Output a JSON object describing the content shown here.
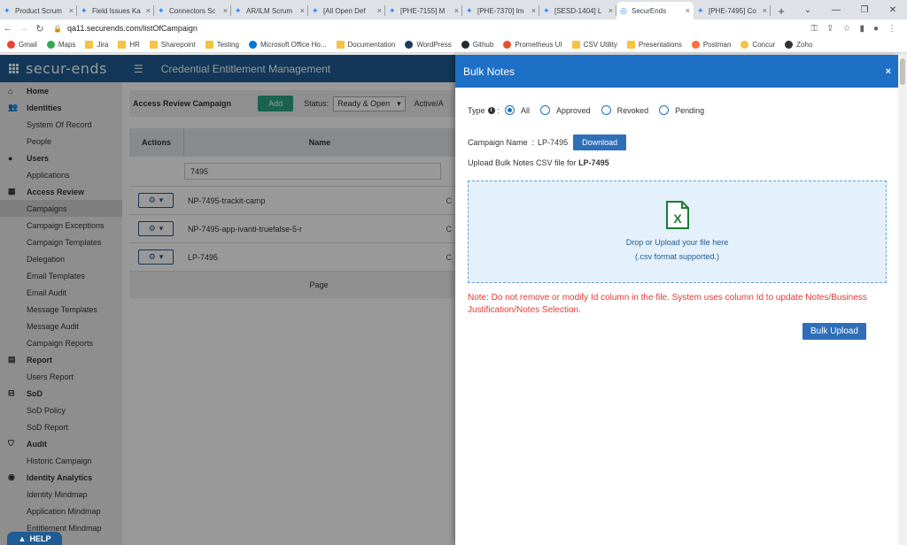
{
  "browser": {
    "tabs": [
      {
        "title": "Product Scrum"
      },
      {
        "title": "Field Issues Ka"
      },
      {
        "title": "Connectors Sc"
      },
      {
        "title": "AR/ILM Scrum"
      },
      {
        "title": "[All Open Def"
      },
      {
        "title": "[PHE-7155] M"
      },
      {
        "title": "[PHE-7370] Im"
      },
      {
        "title": "[SESD-1404] L"
      },
      {
        "title": "SecurEnds"
      },
      {
        "title": "[PHE-7495] Co"
      }
    ],
    "url": "qa11.securends.com/listOfCampaign",
    "bookmarks": [
      "Gmail",
      "Maps",
      "Jira",
      "HR",
      "Sharepoint",
      "Testing",
      "Microsoft Office Ho...",
      "Documentation",
      "WordPress",
      "Github",
      "Prometheus UI",
      "CSV Utility",
      "Presentations",
      "Postman",
      "Concur",
      "Zoho"
    ]
  },
  "app": {
    "logo": "secur-ends",
    "title": "Credential Entitlement Management"
  },
  "sidebar": {
    "items": [
      {
        "label": "Home",
        "kind": "sec",
        "icon": "home-icon"
      },
      {
        "label": "Identities",
        "kind": "sec",
        "icon": "users-icon"
      },
      {
        "label": "System Of Record",
        "kind": "sub"
      },
      {
        "label": "People",
        "kind": "sub"
      },
      {
        "label": "Users",
        "kind": "sec",
        "icon": "user-icon"
      },
      {
        "label": "Applications",
        "kind": "sub"
      },
      {
        "label": "Access Review",
        "kind": "sec",
        "icon": "grid-icon"
      },
      {
        "label": "Campaigns",
        "kind": "sub",
        "selected": true
      },
      {
        "label": "Campaign Exceptions",
        "kind": "sub"
      },
      {
        "label": "Campaign Templates",
        "kind": "sub"
      },
      {
        "label": "Delegation",
        "kind": "sub"
      },
      {
        "label": "Email Templates",
        "kind": "sub"
      },
      {
        "label": "Email Audit",
        "kind": "sub"
      },
      {
        "label": "Message Templates",
        "kind": "sub"
      },
      {
        "label": "Message Audit",
        "kind": "sub"
      },
      {
        "label": "Campaign Reports",
        "kind": "sub"
      },
      {
        "label": "Report",
        "kind": "sec",
        "icon": "report-icon"
      },
      {
        "label": "Users Report",
        "kind": "sub"
      },
      {
        "label": "SoD",
        "kind": "sec",
        "icon": "sod-icon"
      },
      {
        "label": "SoD Policy",
        "kind": "sub"
      },
      {
        "label": "SoD Report",
        "kind": "sub"
      },
      {
        "label": "Audit",
        "kind": "sec",
        "icon": "shield-icon"
      },
      {
        "label": "Historic Campaign",
        "kind": "sub"
      },
      {
        "label": "Identity Analytics",
        "kind": "sec",
        "icon": "analytics-icon"
      },
      {
        "label": "Identity Mindmap",
        "kind": "sub"
      },
      {
        "label": "Application Mindmap",
        "kind": "sub"
      },
      {
        "label": "Entitlement Mindmap",
        "kind": "sub"
      }
    ],
    "help_label": "HELP"
  },
  "campaign_list": {
    "heading": "Access Review Campaign",
    "add_label": "Add",
    "status_label": "Status:",
    "status_value": "Ready & Open",
    "active_label": "Active/A",
    "col_actions": "Actions",
    "col_name": "Name",
    "filter_value": "7495",
    "rows": [
      {
        "name": "NP-7495-trackit-camp",
        "trail": "C"
      },
      {
        "name": "NP-7495-app-ivanti-truefalse-5-r",
        "trail": "C"
      },
      {
        "name": "LP-7495",
        "trail": "C"
      }
    ],
    "pager_label": "Page"
  },
  "modal": {
    "title": "Bulk Notes",
    "close": "×",
    "type_label": "Type",
    "type_colon": ":",
    "info_glyph": "i",
    "type_options": [
      {
        "label": "All",
        "checked": true
      },
      {
        "label": "Approved",
        "checked": false
      },
      {
        "label": "Revoked",
        "checked": false
      },
      {
        "label": "Pending",
        "checked": false
      }
    ],
    "campaign_label": "Campaign Name  :",
    "campaign_value": "LP-7495",
    "download_label": "Download",
    "upload_prefix": "Upload Bulk Notes CSV file for ",
    "upload_campaign": "LP-7495",
    "dropzone_line1": "Drop or Upload your file here",
    "dropzone_line2": "(.csv format supported.)",
    "excel_glyph": "X",
    "note": "Note: Do not remove or modify Id column in the file. System uses column Id to update Notes/Business Justification/Notes Selection.",
    "bulk_upload_label": "Bulk Upload"
  }
}
